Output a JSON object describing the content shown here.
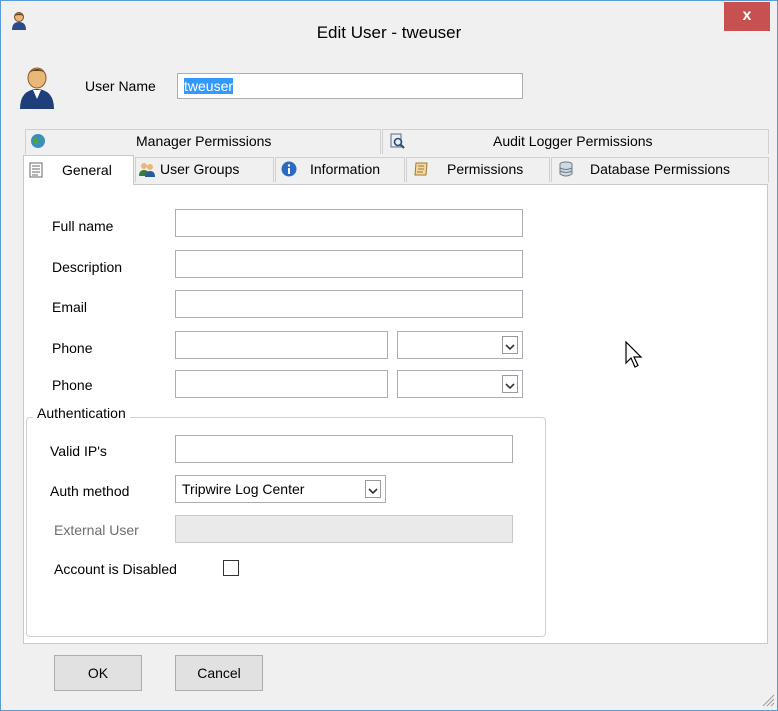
{
  "window": {
    "title": "Edit User - tweuser",
    "close_label": "x"
  },
  "header": {
    "username_label": "User Name",
    "username_value": "tweuser"
  },
  "tabs_top": [
    {
      "label": "Manager Permissions",
      "icon": "globe-icon"
    },
    {
      "label": "Audit Logger Permissions",
      "icon": "document-search-icon"
    }
  ],
  "tabs_bottom": [
    {
      "label": "General",
      "icon": "document-icon",
      "active": true
    },
    {
      "label": "User Groups",
      "icon": "users-icon"
    },
    {
      "label": "Information",
      "icon": "info-icon"
    },
    {
      "label": "Permissions",
      "icon": "scroll-icon"
    },
    {
      "label": "Database Permissions",
      "icon": "database-icon"
    }
  ],
  "general": {
    "full_name_label": "Full name",
    "description_label": "Description",
    "email_label": "Email",
    "phone1_label": "Phone",
    "phone2_label": "Phone",
    "authentication": {
      "legend": "Authentication",
      "valid_ips_label": "Valid IP's",
      "auth_method_label": "Auth method",
      "auth_method_value": "Tripwire Log Center",
      "external_user_label": "External User",
      "account_disabled_label": "Account is Disabled",
      "account_disabled": false
    }
  },
  "buttons": {
    "ok": "OK",
    "cancel": "Cancel"
  },
  "colors": {
    "close_bg": "#c75050",
    "selection": "#3399ff",
    "window_border": "#5a9ad6"
  }
}
